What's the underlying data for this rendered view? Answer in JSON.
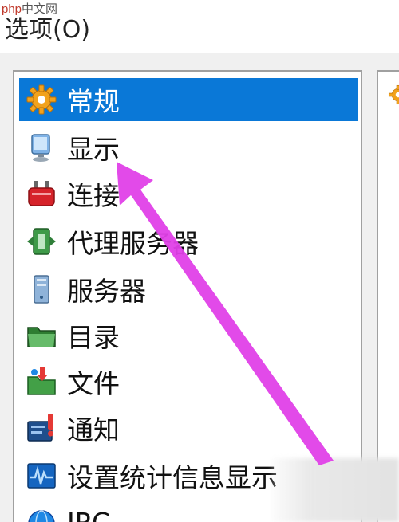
{
  "watermark": {
    "brand": "php",
    "site": "中文网"
  },
  "window": {
    "title": "选项(O)"
  },
  "category_list": {
    "items": [
      {
        "label": "常规",
        "icon": "gear-icon",
        "selected": true
      },
      {
        "label": "显示",
        "icon": "monitor-icon",
        "selected": false
      },
      {
        "label": "连接",
        "icon": "plug-icon",
        "selected": false
      },
      {
        "label": "代理服务器",
        "icon": "proxy-icon",
        "selected": false
      },
      {
        "label": "服务器",
        "icon": "server-icon",
        "selected": false
      },
      {
        "label": "目录",
        "icon": "folder-icon",
        "selected": false
      },
      {
        "label": "文件",
        "icon": "file-download-icon",
        "selected": false
      },
      {
        "label": "通知",
        "icon": "notification-icon",
        "selected": false
      },
      {
        "label": "设置统计信息显示",
        "icon": "statistics-icon",
        "selected": false
      },
      {
        "label": "IRC",
        "icon": "globe-icon",
        "selected": false
      }
    ]
  },
  "colors": {
    "selection": "#0a78d7",
    "annotation_arrow": "#e040e8"
  }
}
